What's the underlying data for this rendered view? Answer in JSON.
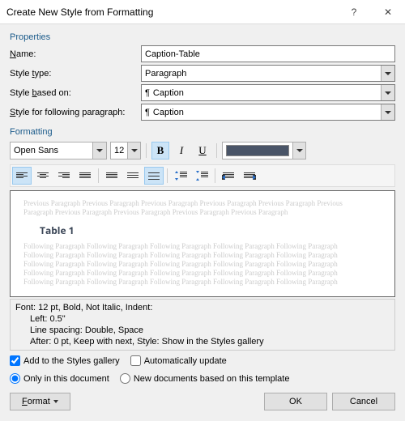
{
  "titlebar": {
    "title": "Create New Style from Formatting",
    "help": "?",
    "close": "✕"
  },
  "sections": {
    "properties": "Properties",
    "formatting": "Formatting"
  },
  "labels": {
    "name": "Name:",
    "style_type": "Style type:",
    "style_based_on": "Style based on:",
    "style_following": "Style for following paragraph:"
  },
  "values": {
    "name": "Caption-Table",
    "style_type": "Paragraph",
    "style_based_on": "Caption",
    "style_following": "Caption"
  },
  "font": {
    "family": "Open Sans",
    "size": "12",
    "bold": "B",
    "italic": "I",
    "underline": "U",
    "color": "#4a5568"
  },
  "preview": {
    "ghost_prev": "Previous Paragraph Previous Paragraph Previous Paragraph Previous Paragraph Previous Paragraph Previous",
    "ghost_prev2": "Paragraph Previous Paragraph Previous Paragraph Previous Paragraph Previous Paragraph",
    "sample": "Table 1",
    "ghost_next": "Following Paragraph Following Paragraph Following Paragraph Following Paragraph Following Paragraph"
  },
  "description": {
    "line1": "Font: 12 pt, Bold, Not Italic, Indent:",
    "line2": "Left:  0.5\"",
    "line3": "Line spacing:  Double, Space",
    "line4": "After:  0 pt, Keep with next, Style: Show in the Styles gallery"
  },
  "checkboxes": {
    "add_gallery": "Add to the Styles gallery",
    "auto_update": "Automatically update",
    "only_doc": "Only in this document",
    "new_docs": "New documents based on this template"
  },
  "buttons": {
    "format": "Format",
    "ok": "OK",
    "cancel": "Cancel"
  }
}
